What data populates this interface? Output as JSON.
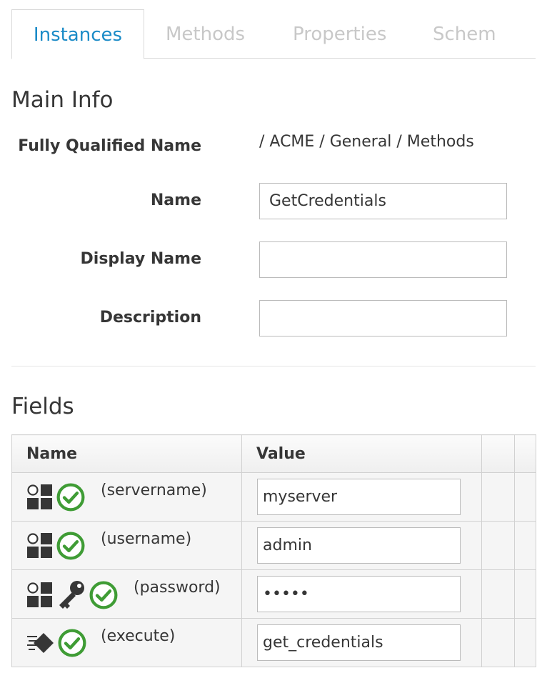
{
  "tabs": [
    {
      "label": "Instances",
      "active": true
    },
    {
      "label": "Methods",
      "active": false
    },
    {
      "label": "Properties",
      "active": false
    },
    {
      "label": "Schem",
      "active": false
    }
  ],
  "main_info": {
    "title": "Main Info",
    "fqn_label": "Fully Qualified Name",
    "fqn_value": "/ ACME / General / Methods",
    "name_label": "Name",
    "name_value": "GetCredentials",
    "display_name_label": "Display Name",
    "display_name_value": "",
    "description_label": "Description",
    "description_value": ""
  },
  "fields": {
    "title": "Fields",
    "columns": [
      "Name",
      "Value"
    ],
    "rows": [
      {
        "icons": [
          "attribute-icon",
          "valid-check-icon"
        ],
        "name": "(servername)",
        "value": "myserver"
      },
      {
        "icons": [
          "attribute-icon",
          "valid-check-icon"
        ],
        "name": "(username)",
        "value": "admin"
      },
      {
        "icons": [
          "attribute-icon",
          "key-icon",
          "valid-check-icon"
        ],
        "name": "(password)",
        "value": "•••••"
      },
      {
        "icons": [
          "method-icon",
          "valid-check-icon"
        ],
        "name": "(execute)",
        "value": "get_credentials"
      }
    ]
  },
  "colors": {
    "accent": "#1b8bc7",
    "check": "#3f9c35",
    "icon": "#363636"
  }
}
